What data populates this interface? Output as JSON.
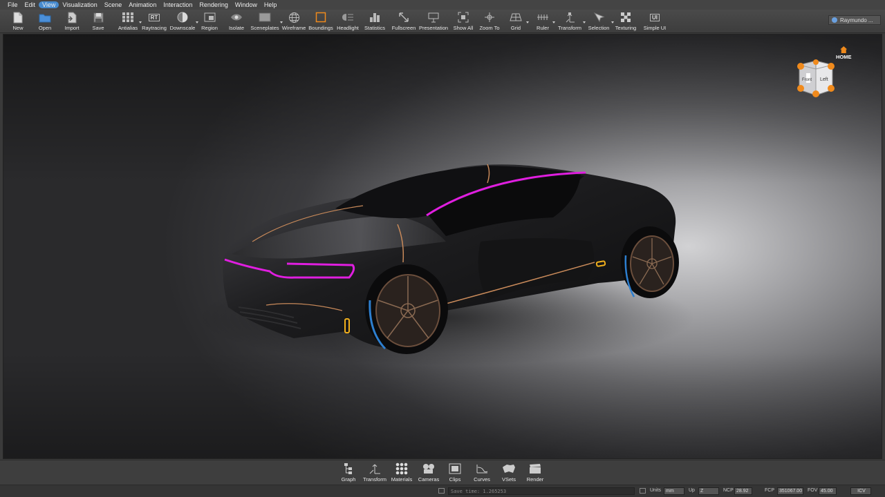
{
  "menu": [
    "File",
    "Edit",
    "View",
    "Visualization",
    "Scene",
    "Animation",
    "Interaction",
    "Rendering",
    "Window",
    "Help"
  ],
  "toolbar": {
    "new": "New",
    "open": "Open",
    "import": "Import",
    "save": "Save",
    "antialias": "Antialias",
    "raytracing": "Raytracing",
    "downscale": "Downscale",
    "region": "Region",
    "isolate": "Isolate",
    "sceneplates": "Sceneplates",
    "wireframe": "Wireframe",
    "boundings": "Boundings",
    "headlight": "Headlight",
    "statistics": "Statistics",
    "fullscreen": "Fullscreen",
    "presentation": "Presentation",
    "show_all": "Show All",
    "zoom_to": "Zoom To",
    "grid": "Grid",
    "ruler": "Ruler",
    "transform": "Transform",
    "selection": "Selection",
    "texturing": "Texturing",
    "simple_ui": "Simple UI",
    "rt_icon_text": "RT",
    "ui_icon_text": "UI"
  },
  "user": {
    "name": "Raymundo ..."
  },
  "navcube": {
    "home": "HOME",
    "face_front": "Front",
    "face_left": "Left"
  },
  "dock": {
    "graph": "Graph",
    "transform": "Transform",
    "materials": "Materials",
    "cameras": "Cameras",
    "clips": "Clips",
    "curves": "Curves",
    "vsets": "VSets",
    "render": "Render"
  },
  "status": {
    "save_time": "Save time: 1.265253",
    "units_label": "Units",
    "units_value": "mm",
    "up_label": "Up",
    "up_value": "Z",
    "ncp_label": "NCP",
    "ncp_value": "28.92",
    "fcp_label": "FCP",
    "fcp_value": "351067.00",
    "fov_label": "FOV",
    "fov_value": "45.00",
    "mode": "ICV"
  },
  "colors": {
    "accent_orange": "#f08a1c",
    "highlight_magenta": "#e01ee0",
    "trim_copper": "#c98a5a",
    "menu_hover_blue": "#4696e6"
  }
}
